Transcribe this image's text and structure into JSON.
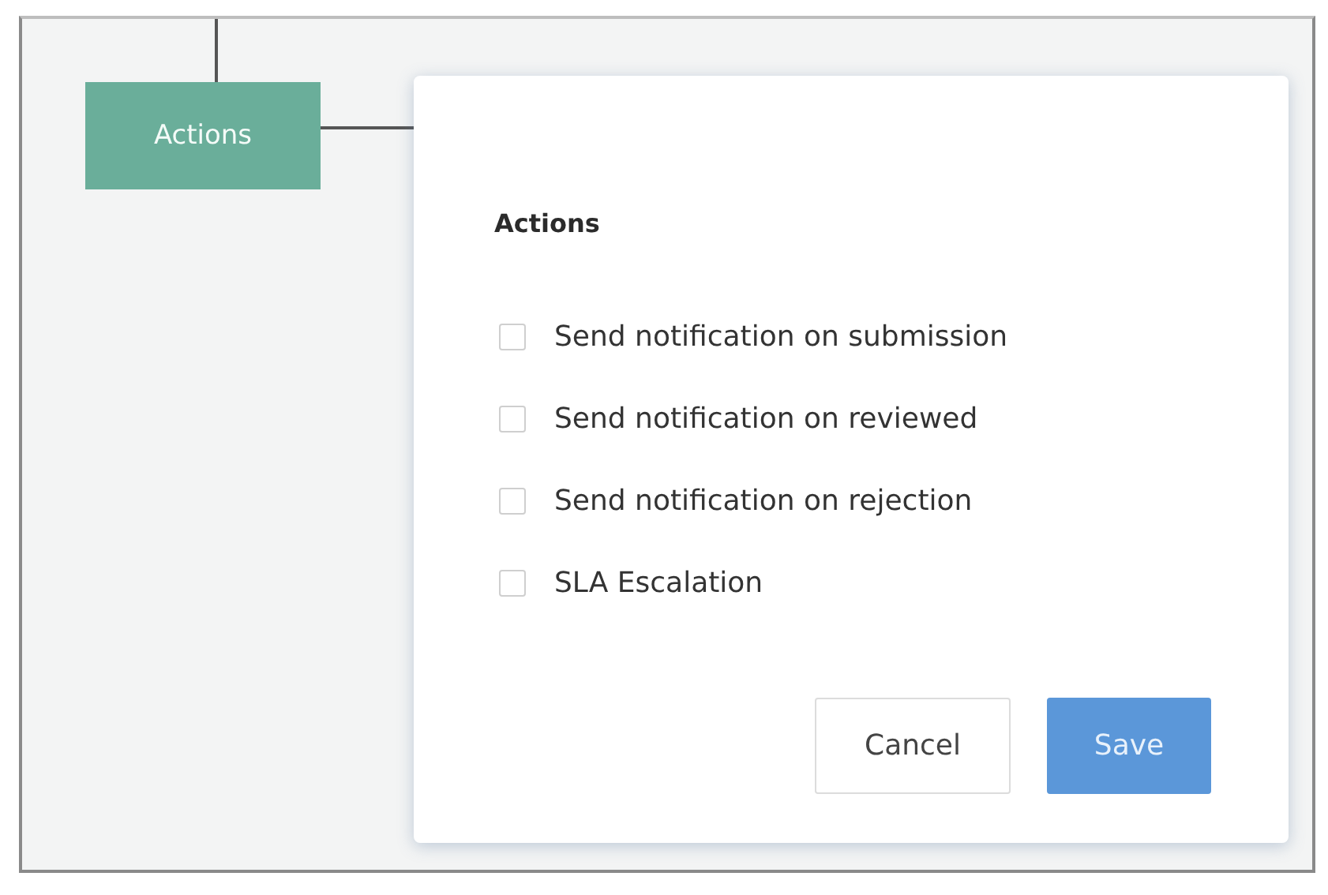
{
  "node": {
    "label": "Actions"
  },
  "dialog": {
    "title": "Actions",
    "options": [
      {
        "label": "Send notification on submission",
        "checked": false
      },
      {
        "label": "Send notification on reviewed",
        "checked": false
      },
      {
        "label": "Send notification on rejection",
        "checked": false
      },
      {
        "label": "SLA Escalation",
        "checked": false
      }
    ],
    "buttons": [
      {
        "label": "Cancel",
        "kind": "secondary"
      },
      {
        "label": "Save",
        "kind": "primary"
      }
    ]
  }
}
